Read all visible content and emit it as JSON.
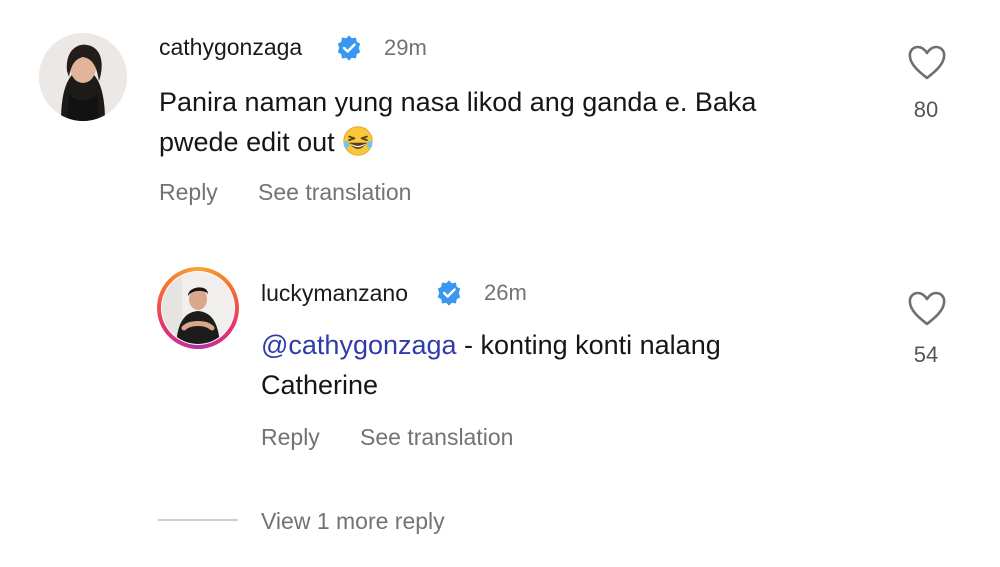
{
  "comments": [
    {
      "username": "cathygonzaga",
      "time": "29m",
      "text_line1": "Panira naman yung nasa likod ang ganda e. Baka",
      "text_line2": "pwede edit out",
      "emoji": "grinning-squinting-face-with-tears-emoji",
      "likes": "80",
      "reply_label": "Reply",
      "translate_label": "See translation",
      "verified": true
    },
    {
      "username": "luckymanzano",
      "time": "26m",
      "mention": "@cathygonzaga",
      "text_line1": " - konting konti nalang",
      "text_line2": "Catherine",
      "likes": "54",
      "reply_label": "Reply",
      "translate_label": "See translation",
      "verified": true,
      "has_story": true
    }
  ],
  "view_more_replies": "View 1 more reply",
  "colors": {
    "verified": "#3a97f0",
    "mention": "#2f3ba8",
    "secondary_text": "#737373"
  }
}
